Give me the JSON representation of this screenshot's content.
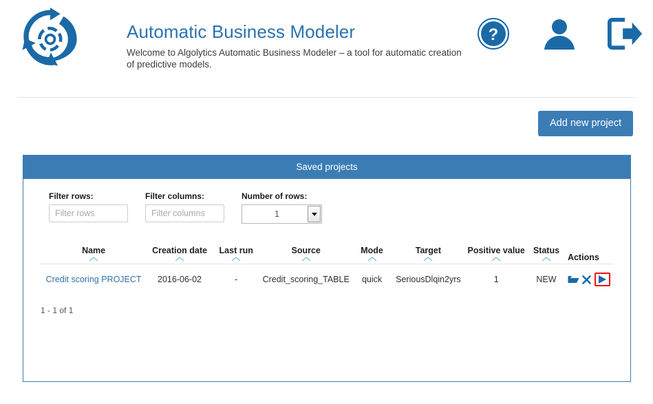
{
  "header": {
    "logo_icon": "algolytics-circular-logo",
    "title": "Automatic Business Modeler",
    "subtitle": "Welcome to Algolytics Automatic Business Modeler – a tool for automatic creation of predictive models.",
    "icons": [
      {
        "name": "help-icon",
        "label": "?"
      },
      {
        "name": "user-icon",
        "label": ""
      },
      {
        "name": "logout-icon",
        "label": ""
      }
    ]
  },
  "toolbar": {
    "add_project_label": "Add new project"
  },
  "panel": {
    "heading": "Saved projects",
    "filters": {
      "rows_label": "Filter rows:",
      "rows_placeholder": "Filter rows",
      "rows_value": "",
      "columns_label": "Filter columns:",
      "columns_placeholder": "Filter columns",
      "columns_value": "",
      "number_label": "Number of rows:",
      "number_value": "1"
    },
    "table": {
      "columns": [
        "Name",
        "Creation date",
        "Last run",
        "Source",
        "Mode",
        "Target",
        "Positive value",
        "Status",
        "Actions"
      ],
      "rows": [
        {
          "name": "Credit scoring PROJECT",
          "creation_date": "2016-06-02",
          "last_run": "-",
          "source": "Credit_scoring_TABLE",
          "mode": "quick",
          "target": "SeriousDlqin2yrs",
          "positive_value": "1",
          "status": "NEW",
          "actions": [
            {
              "name": "open-folder-icon"
            },
            {
              "name": "delete-x-icon"
            },
            {
              "name": "run-play-icon",
              "highlighted": true
            }
          ]
        }
      ]
    },
    "pager": "1 - 1 of 1"
  },
  "colors": {
    "brand_blue": "#3b7cb5",
    "logo_blue": "#1a6aa8",
    "title_blue": "#2b72b0",
    "link_blue": "#3072ac",
    "highlight_red": "#ee1111",
    "sort_caret": "#9ec4e0"
  }
}
